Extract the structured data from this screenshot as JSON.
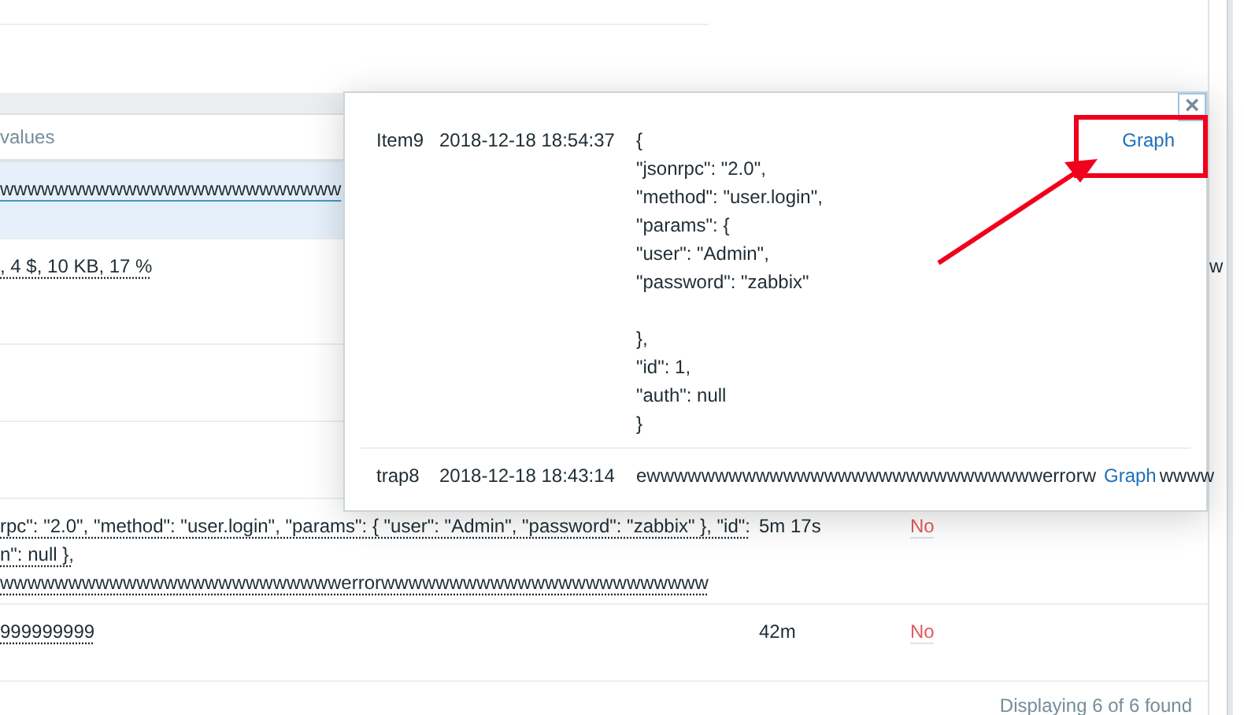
{
  "table": {
    "columns": [
      {
        "label": "values"
      }
    ],
    "rows": [
      {
        "selected": true,
        "value": "wwwwwwwwwwwwwwwwwwwwwwwww"
      },
      {
        "selected": false,
        "value": ", 4 $, 10 KB, 17 %",
        "column_4": "w"
      },
      {
        "selected": false
      },
      {
        "selected": false
      },
      {
        "selected": false,
        "value": "rpc\": \"2.0\", \"method\": \"user.login\", \"params\": { \"user\": \"Admin\", \"password\": \"zabbix\" }, \"id\":\nn\": null },\nwwwwwwwwwwwwwwwwwwwwwwwwwerrorwwwwwwwwwwwwwwwwwwwwwwww",
        "duration": "5m 17s",
        "status": "No"
      },
      {
        "selected": false,
        "value": "999999999",
        "duration": "42m",
        "status": "No"
      }
    ]
  },
  "popup": {
    "close": "×",
    "rows": [
      {
        "name": "Item9",
        "time": "2018-12-18 18:54:37",
        "value": "{\n\"jsonrpc\": \"2.0\",\n\"method\": \"user.login\",\n\"params\": {\n\"user\": \"Admin\",\n\"password\": \"zabbix\"\n\n},\n\"id\": 1,\n\"auth\": null\n}",
        "link": "Graph"
      },
      {
        "name": "trap8",
        "time": "2018-12-18 18:43:14",
        "value": "ewwwwwwwwwwwwwwwwwwwwwwwwwwwwwerrorw",
        "link": "Graph",
        "value_end": "wwww"
      }
    ]
  },
  "footer": "Displaying 6 of 6 found"
}
